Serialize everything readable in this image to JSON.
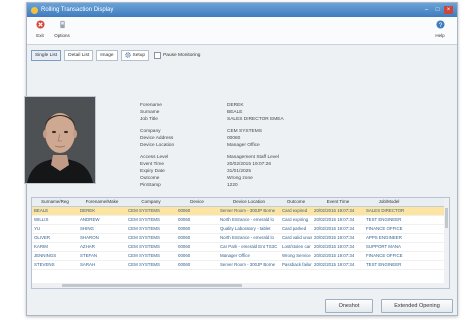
{
  "window": {
    "title": "Rolling Transaction Display"
  },
  "ribbon": {
    "exit_label": "Exit",
    "options_label": "Options",
    "help_label": "Help"
  },
  "tabs": [
    {
      "label": "Single List"
    },
    {
      "label": "Detail List"
    },
    {
      "label": "Image"
    },
    {
      "label": "Setup"
    }
  ],
  "pause_label": "Pause Monitoring",
  "details": [
    {
      "label": "Forename",
      "value": "DEREK"
    },
    {
      "label": "Surname",
      "value": "BEALE"
    },
    {
      "label": "Job Title",
      "value": "SALES DIRECTOR EMEA"
    },
    {
      "label": "Company",
      "value": "CEM SYSTEMS"
    },
    {
      "label": "Device Address",
      "value": "00060"
    },
    {
      "label": "Device Location",
      "value": "Manager Office"
    },
    {
      "label": "Access Level",
      "value": "Management Staff Level"
    },
    {
      "label": "Event Time",
      "value": "20/02/2015 19:07:26"
    },
    {
      "label": "Expiry Date",
      "value": "31/01/2025"
    },
    {
      "label": "Outcome",
      "value": "Wrong zone"
    },
    {
      "label": "PinStamp",
      "value": "1220"
    }
  ],
  "grid": {
    "columns": [
      "Surname/Reg",
      "Forename/Make",
      "Company",
      "Device",
      "Device Location",
      "Outcome",
      "Event Time",
      "Job/Model"
    ],
    "rows": [
      [
        "BEALE",
        "DEREK",
        "CEM SYSTEMS",
        "00060",
        "Server Room - 300JP Borne",
        "Card expired",
        "20/02/2015 19:07:34",
        "SALES DIRECTOR"
      ],
      [
        "WILLIS",
        "ANDREW",
        "CEM SYSTEMS",
        "00060",
        "North Entrance - emerald lo",
        "Card expiring",
        "20/02/2015 19:07:34",
        "TEST ENGINEER"
      ],
      [
        "YU",
        "SHING",
        "CEM SYSTEMS",
        "00060",
        "Quality Laboratory - tablet",
        "Card parked",
        "20/02/2015 19:07:34",
        "FINANCE OFFICE"
      ],
      [
        "OLIVER",
        "SHARON",
        "CEM SYSTEMS",
        "00060",
        "North Entrance - emerald lo",
        "Card valid unus",
        "20/02/2015 19:07:34",
        "APPS ENGINEER"
      ],
      [
        "KARIM",
        "AZHAR",
        "CEM SYSTEMS",
        "00060",
        "Car Park - emerald Ent TS3C",
        "Lost/stolen car",
        "20/02/2015 19:07:34",
        "SUPPORT MANA"
      ],
      [
        "JENNINGS",
        "STEFAN",
        "CEM SYSTEMS",
        "00060",
        "Manager Office",
        "Wrong Service",
        "20/02/2015 19:07:34",
        "FINANCE OFFICE"
      ],
      [
        "STEVENS",
        "SARAH",
        "CEM SYSTEMS",
        "00060",
        "Server Room - 300JP Borne",
        "Passback failure",
        "20/02/2015 19:07:34",
        "TEST ENGINEER"
      ]
    ]
  },
  "buttons": {
    "oneshot": "Oneshot",
    "extended": "Extended Opening"
  },
  "colors": {
    "title_bar": "#3f7bbd",
    "selected_row": "#fce4a2",
    "exit_icon": "#d9453b"
  }
}
